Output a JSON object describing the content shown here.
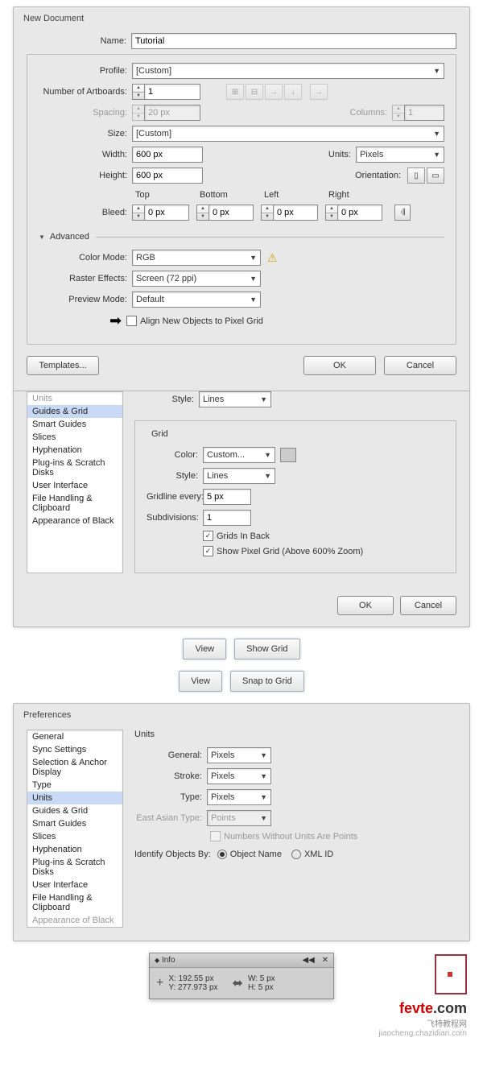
{
  "newDoc": {
    "title": "New Document",
    "labels": {
      "name": "Name:",
      "profile": "Profile:",
      "artboards": "Number of Artboards:",
      "spacing": "Spacing:",
      "columns": "Columns:",
      "size": "Size:",
      "width": "Width:",
      "height": "Height:",
      "units": "Units:",
      "orientation": "Orientation:",
      "bleed": "Bleed:",
      "top": "Top",
      "bottom": "Bottom",
      "left": "Left",
      "right": "Right",
      "advanced": "Advanced",
      "colorMode": "Color Mode:",
      "raster": "Raster Effects:",
      "preview": "Preview Mode:",
      "alignPixel": "Align New Objects to Pixel Grid"
    },
    "values": {
      "name": "Tutorial",
      "profile": "[Custom]",
      "artboards": "1",
      "spacing": "20 px",
      "columns": "1",
      "size": "[Custom]",
      "width": "600 px",
      "height": "600 px",
      "units": "Pixels",
      "bleedTop": "0 px",
      "bleedBottom": "0 px",
      "bleedLeft": "0 px",
      "bleedRight": "0 px",
      "colorMode": "RGB",
      "raster": "Screen (72 ppi)",
      "preview": "Default"
    },
    "buttons": {
      "templates": "Templates...",
      "ok": "OK",
      "cancel": "Cancel"
    }
  },
  "prefs1": {
    "sidebar": [
      "Units",
      "Guides & Grid",
      "Smart Guides",
      "Slices",
      "Hyphenation",
      "Plug-ins & Scratch Disks",
      "User Interface",
      "File Handling & Clipboard",
      "Appearance of Black"
    ],
    "selected": "Guides & Grid",
    "faded": "Units",
    "labels": {
      "style": "Style:",
      "grid": "Grid",
      "color": "Color:",
      "gridline": "Gridline every:",
      "subdivisions": "Subdivisions:",
      "gridsBack": "Grids In Back",
      "showPixel": "Show Pixel Grid (Above 600% Zoom)"
    },
    "values": {
      "style1": "Lines",
      "color": "Custom...",
      "style2": "Lines",
      "gridline": "5 px",
      "subdivisions": "1"
    },
    "buttons": {
      "ok": "OK",
      "cancel": "Cancel"
    }
  },
  "middle": {
    "view1": "View",
    "showGrid": "Show Grid",
    "view2": "View",
    "snapGrid": "Snap to Grid"
  },
  "prefs2": {
    "title": "Preferences",
    "sidebar": [
      "General",
      "Sync Settings",
      "Selection & Anchor Display",
      "Type",
      "Units",
      "Guides & Grid",
      "Smart Guides",
      "Slices",
      "Hyphenation",
      "Plug-ins & Scratch Disks",
      "User Interface",
      "File Handling & Clipboard",
      "Appearance of Black"
    ],
    "selected": "Units",
    "section": "Units",
    "labels": {
      "general": "General:",
      "stroke": "Stroke:",
      "type": "Type:",
      "eastAsian": "East Asian Type:",
      "numbersPoints": "Numbers Without Units Are Points",
      "identify": "Identify Objects By:",
      "objName": "Object Name",
      "xmlId": "XML ID"
    },
    "values": {
      "general": "Pixels",
      "stroke": "Pixels",
      "type": "Pixels",
      "eastAsian": "Points"
    }
  },
  "info": {
    "title": "Info",
    "labels": {
      "x": "X:",
      "y": "Y:",
      "w": "W:",
      "h": "H:"
    },
    "values": {
      "x": "192.55 px",
      "y": "277.973 px",
      "w": "5 px",
      "h": "5 px"
    }
  },
  "watermark": {
    "brand": "fevte",
    "tld": ".com",
    "sub": "飞特教程网",
    "url": "jiaocheng.chazidian.com"
  }
}
